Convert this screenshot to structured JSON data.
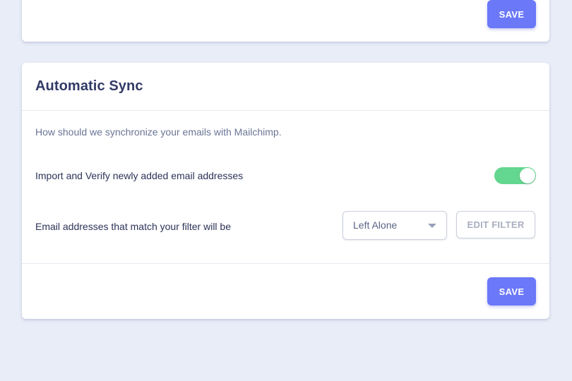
{
  "top_card": {
    "save_label": "SAVE"
  },
  "sync_card": {
    "title": "Automatic Sync",
    "description": "How should we synchronize your emails with Mailchimp.",
    "import_label": "Import and Verify newly added email addresses",
    "import_toggle_on": true,
    "filter_label": "Email addresses that match your filter will be",
    "filter_select_value": "Left Alone",
    "edit_filter_label": "EDIT FILTER",
    "save_label": "SAVE"
  },
  "colors": {
    "background": "#e9edf8",
    "primary": "#6b78f8",
    "toggle_on": "#63d68f",
    "title": "#323a66"
  }
}
